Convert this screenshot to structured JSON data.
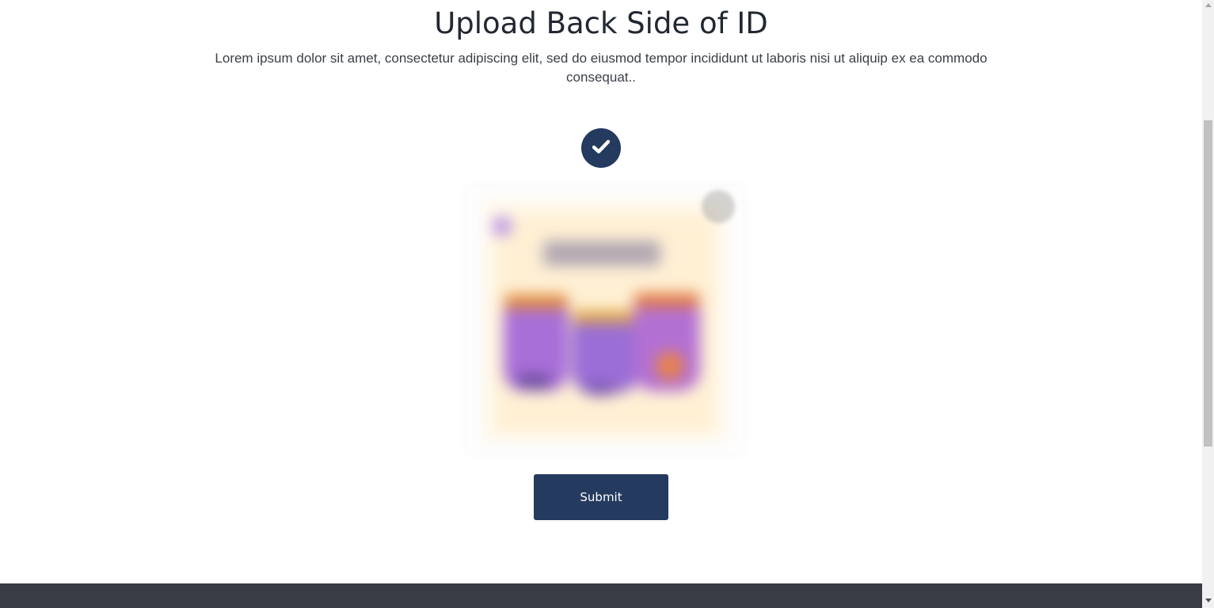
{
  "page": {
    "title": "Upload Back Side of ID",
    "description": "Lorem ipsum dolor sit amet, consectetur adipiscing elit, sed do eiusmod tempor incididunt ut laboris nisi ut aliquip ex ea commodo consequat.."
  },
  "upload": {
    "status_icon": "check-icon",
    "preview_icon": "image-preview",
    "remove_icon": "close-icon"
  },
  "actions": {
    "submit_label": "Submit"
  },
  "colors": {
    "primary": "#243a5e",
    "footer": "#373c45",
    "text": "#222831"
  }
}
